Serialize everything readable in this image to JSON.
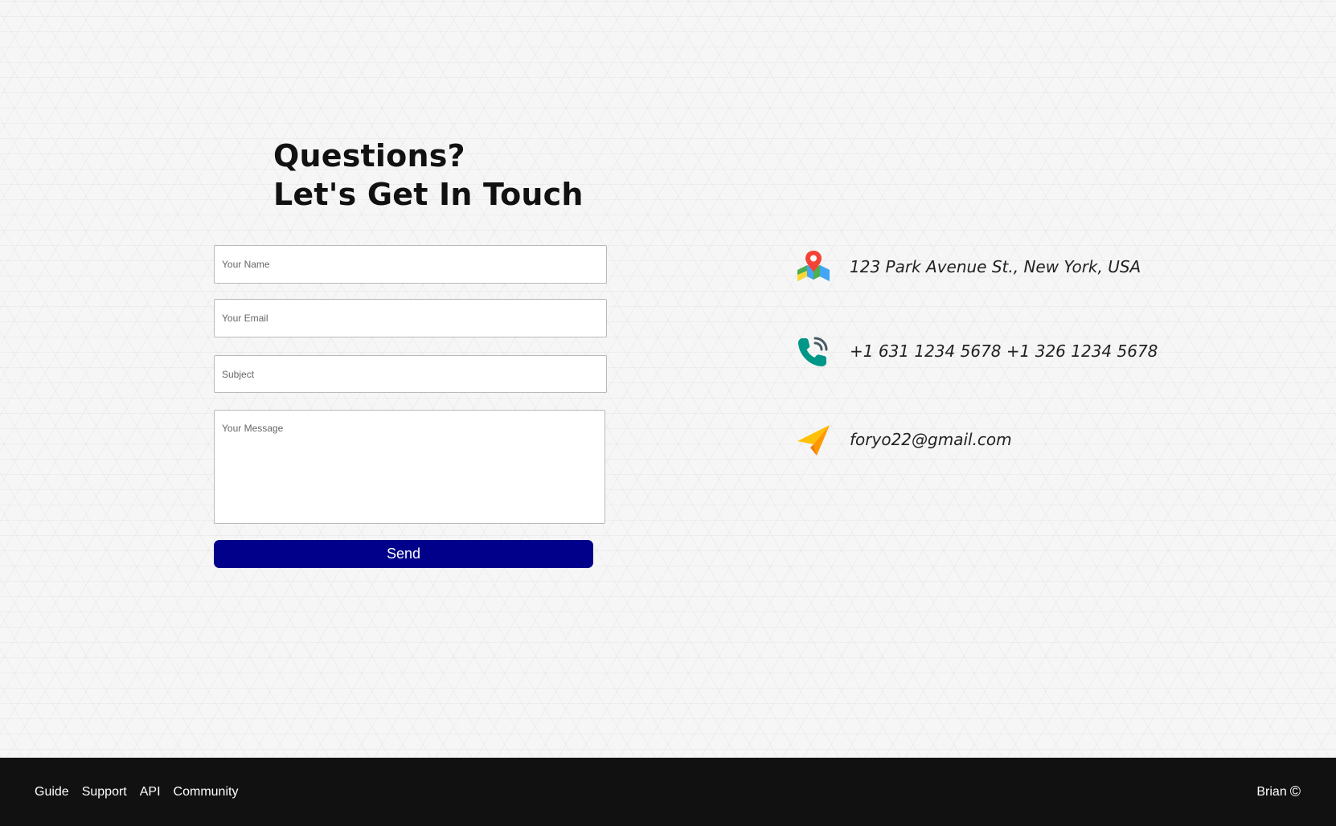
{
  "contact": {
    "heading_line1": "Questions?",
    "heading_line2": "Let's Get In Touch"
  },
  "form": {
    "name_placeholder": "Your Name",
    "email_placeholder": "Your Email",
    "subject_placeholder": "Subject",
    "message_placeholder": "Your Message",
    "send_label": "Send",
    "accent_color": "#00008b"
  },
  "info": {
    "address": "123 Park Avenue St., New York, USA",
    "address_icon": "map-pin-icon",
    "phone": "+1 631 1234 5678 +1 326 1234 5678",
    "phone_icon": "phone-icon",
    "email": "foryo22@gmail.com",
    "email_icon": "paper-plane-icon"
  },
  "footer": {
    "links": [
      "Guide",
      "Support",
      "API",
      "Community"
    ],
    "credit": "Brian",
    "copyright_symbol": "©",
    "background": "#111111"
  }
}
